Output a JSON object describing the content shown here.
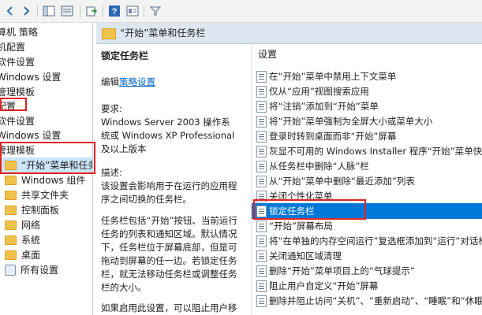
{
  "toolbar": {
    "buttons": [
      "back-icon",
      "forward-icon",
      "show-hide-tree-icon",
      "view-icon",
      "export-icon",
      "help-icon",
      "properties-icon",
      "filter-icon"
    ]
  },
  "tree": {
    "items": [
      {
        "label": "算机 策略",
        "icon": "settings"
      },
      {
        "label": "机配置",
        "icon": "settings"
      },
      {
        "label": "软件设置",
        "icon": "folder"
      },
      {
        "label": "Windows 设置",
        "icon": "folder"
      },
      {
        "label": "管理模板",
        "icon": "folder"
      },
      {
        "label": "配置",
        "icon": "settings"
      },
      {
        "label": "软件设置",
        "icon": "folder"
      },
      {
        "label": "Windows 设置",
        "icon": "folder"
      },
      {
        "label": "管理模板",
        "icon": "folder"
      },
      {
        "label": "“开始”菜单和任务栏",
        "icon": "folder"
      },
      {
        "label": "Windows 组件",
        "icon": "folder"
      },
      {
        "label": "共享文件夹",
        "icon": "folder"
      },
      {
        "label": "控制面板",
        "icon": "folder"
      },
      {
        "label": "网络",
        "icon": "folder"
      },
      {
        "label": "系统",
        "icon": "folder"
      },
      {
        "label": "桌面",
        "icon": "folder"
      },
      {
        "label": "所有设置",
        "icon": "settings"
      }
    ]
  },
  "main": {
    "header_title": "“开始”菜单和任务栏",
    "description": {
      "title": "锁定任务栏",
      "edit_prefix": "编辑",
      "edit_link": "策略设置",
      "requirements_label": "要求:",
      "requirements_text": "Windows Server 2003 操作系统或 Windows XP Professional 及以上版本",
      "description_label": "描述:",
      "description_text": "该设置会影响用于在运行的应用程序之间切换的任务栏。",
      "detail_text": "任务栏包括“开始”按钮、当前运行任务的列表和通知区域。默认情况下，任务栏位于屏幕底部，但是可拖动到屏幕的任一边。若锁定任务栏，就无法移动任务栏或调整任务栏的大小。",
      "extra_text": "如果启用此设置，可以阻止用户移"
    },
    "settings": {
      "header": "设置",
      "items": [
        "在“开始”菜单中禁用上下文菜单",
        "仅从“应用”视图搜索应用",
        "将“注销”添加到“开始”菜单",
        "将“开始”菜单强制为全屏大小或菜单大小",
        "登录时转到桌面而非“开始”屏幕",
        "灰显不可用的 Windows Installer 程序“开始”菜单快捷",
        "从任务栏中删除“人脉”栏",
        "从“开始”菜单中删除“最近添加”列表",
        "关闭个性化菜单",
        "锁定任务栏",
        "“开始”屏幕布局",
        "将“在单独的内存空间运行”复选框添加到“运行”对话框",
        "关闭通知区域清理",
        "删除“开始”菜单项目上的“气球提示”",
        "阻止用户自定义“开始”屏幕",
        "删除并阻止访问“关机”、“重新启动”、“睡眠”和“休眠”"
      ],
      "selected_index": 9
    }
  },
  "colors": {
    "selection": "#0078d7",
    "tree_selection": "#cce4f7",
    "highlight_box": "#e02424",
    "header_bar": "#dde6f1"
  }
}
